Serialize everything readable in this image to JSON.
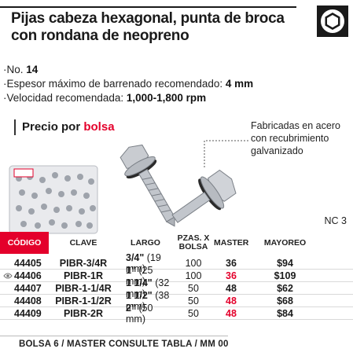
{
  "title": "Pijas cabeza hexagonal, punta de broca con rondana de neopreno",
  "icon": "hex-head-icon",
  "specs": [
    {
      "label": "No. ",
      "value": "14"
    },
    {
      "label": "Espesor máximo de barrenado recomendado: ",
      "value": "4 mm"
    },
    {
      "label": "Velocidad recomendada: ",
      "value": "1,000-1,800 rpm"
    }
  ],
  "price": {
    "label": "Precio por ",
    "unit": "bolsa"
  },
  "fabrication_note": "Fabricadas en acero con recubrimiento galvanizado",
  "nc": "NC 3",
  "table": {
    "headers": {
      "code": "CÓDIGO",
      "clave": "CLAVE",
      "largo": "LARGO",
      "pzas": "PZAS. X BOLSA",
      "master": "MASTER",
      "mayoreo": "MAYOREO"
    },
    "rows": [
      {
        "code": "44405",
        "clave": "PIBR-3/4R",
        "largo_frac": "3/4\"",
        "largo_mm": "(19 mm)",
        "pzas": "100",
        "master": "36",
        "master_red": false,
        "price": "$94"
      },
      {
        "code": "44406",
        "clave": "PIBR-1R",
        "largo_frac": "1\"",
        "largo_mm": "(25 mm)",
        "pzas": "100",
        "master": "36",
        "master_red": true,
        "price": "$109"
      },
      {
        "code": "44407",
        "clave": "PIBR-1-1/4R",
        "largo_frac": "1 1/4\"",
        "largo_mm": "(32 mm)",
        "pzas": "50",
        "master": "48",
        "master_red": false,
        "price": "$62"
      },
      {
        "code": "44408",
        "clave": "PIBR-1-1/2R",
        "largo_frac": "1 1/2\"",
        "largo_mm": "(38 mm)",
        "pzas": "50",
        "master": "48",
        "master_red": true,
        "price": "$68"
      },
      {
        "code": "44409",
        "clave": "PIBR-2R",
        "largo_frac": "2\"",
        "largo_mm": "(50 mm)",
        "pzas": "50",
        "master": "48",
        "master_red": true,
        "price": "$84"
      }
    ]
  },
  "footer": "BOLSA 6 / MASTER CONSULTE TABLA / MM 00",
  "colors": {
    "accent": "#e4002b",
    "text": "#1a1a1a"
  }
}
